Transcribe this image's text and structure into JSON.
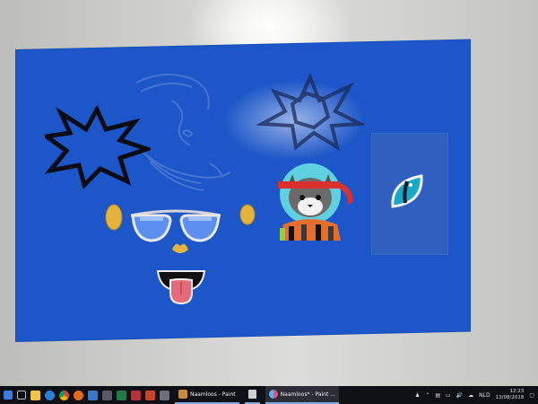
{
  "app": {
    "canvas_color": "#1c56c8",
    "accent_color": "#7fa7e0"
  },
  "taskbar": {
    "pinned_icons": [
      "windows-explorer-icon",
      "store-icon",
      "chrome-icon",
      "firefox-icon",
      "edge-icon",
      "media-icon",
      "excel-icon",
      "paint-icon",
      "photos-icon"
    ],
    "tasks": [
      {
        "label": "Naamloos - Paint",
        "icon": "paint-icon"
      },
      {
        "label": "",
        "icon": "calculator-icon"
      },
      {
        "label": "Naamloos* - Paint ...",
        "icon": "paint3d-icon"
      }
    ],
    "tray": {
      "language": "NLD",
      "time": "12:23",
      "date": "13/08/2018"
    }
  }
}
